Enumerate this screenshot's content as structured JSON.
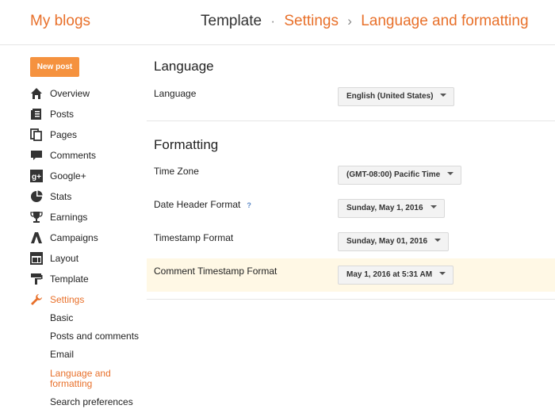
{
  "header": {
    "brand": "My blogs",
    "breadcrumb": [
      "Template",
      "Settings",
      "Language and formatting"
    ],
    "sep1": "·",
    "sep2": "›"
  },
  "sidebar": {
    "new_post_label": "New post",
    "items": [
      {
        "label": "Overview",
        "icon": "home-icon"
      },
      {
        "label": "Posts",
        "icon": "posts-icon"
      },
      {
        "label": "Pages",
        "icon": "pages-icon"
      },
      {
        "label": "Comments",
        "icon": "comments-icon"
      },
      {
        "label": "Google+",
        "icon": "google-plus-icon"
      },
      {
        "label": "Stats",
        "icon": "stats-icon"
      },
      {
        "label": "Earnings",
        "icon": "trophy-icon"
      },
      {
        "label": "Campaigns",
        "icon": "campaigns-icon"
      },
      {
        "label": "Layout",
        "icon": "layout-icon"
      },
      {
        "label": "Template",
        "icon": "template-icon"
      },
      {
        "label": "Settings",
        "icon": "wrench-icon",
        "active": true
      }
    ],
    "subitems": [
      {
        "label": "Basic"
      },
      {
        "label": "Posts and comments"
      },
      {
        "label": "Email"
      },
      {
        "label": "Language and formatting",
        "active": true
      },
      {
        "label": "Search preferences"
      }
    ]
  },
  "main": {
    "language_section": {
      "title": "Language",
      "language_label": "Language",
      "language_value": "English (United States)"
    },
    "formatting_section": {
      "title": "Formatting",
      "timezone_label": "Time Zone",
      "timezone_value": "(GMT-08:00) Pacific Time",
      "date_header_label": "Date Header Format",
      "date_header_help": "?",
      "date_header_value": "Sunday, May 1, 2016",
      "timestamp_label": "Timestamp Format",
      "timestamp_value": "Sunday, May 01, 2016",
      "comment_timestamp_label": "Comment Timestamp Format",
      "comment_timestamp_value": "May 1, 2016 at 5:31 AM"
    }
  },
  "colors": {
    "accent": "#e8702a",
    "button": "#f5923f",
    "highlight_row": "#fff8e5"
  }
}
